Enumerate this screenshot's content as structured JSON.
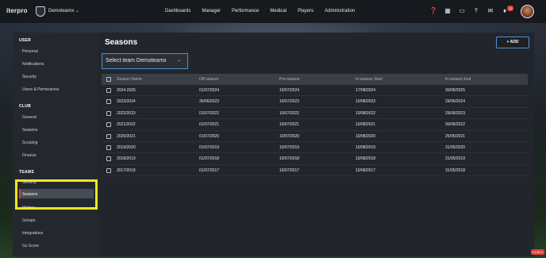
{
  "topbar": {
    "logo": "iterpro",
    "team_name": "Demoteamx",
    "nav": [
      "Dashboards",
      "Manager",
      "Performance",
      "Medical",
      "Players",
      "Administration"
    ],
    "notification_count": "13"
  },
  "sidebar": {
    "user_heading": "USER",
    "user_items": [
      "Personal",
      "Notifications",
      "Security",
      "Users & Permissions"
    ],
    "club_heading": "CLUB",
    "club_items": [
      "General",
      "Seasons",
      "Scouting",
      "Finance"
    ],
    "teams_heading": "TEAMS",
    "teams_items": [
      "General",
      "Seasons",
      "Metrics",
      "Groups",
      "Integrations",
      "Go Score"
    ]
  },
  "main": {
    "title": "Seasons",
    "add_label": "+ ADD",
    "team_select_label": "Select team",
    "team_select_value": "Demoteamx",
    "columns": [
      "Season Name",
      "Off-season",
      "Pre-season",
      "In-season Start",
      "In-season End"
    ],
    "rows": [
      [
        "2024-2025",
        "01/07/2024",
        "10/07/2024",
        "17/08/2024",
        "30/06/2025"
      ],
      [
        "2023/2024",
        "30/06/2023",
        "10/07/2023",
        "10/08/2023",
        "29/06/2024"
      ],
      [
        "2022/2023",
        "01/07/2022",
        "10/07/2022",
        "10/08/2022",
        "29/06/2023"
      ],
      [
        "2021/2022",
        "01/07/2021",
        "10/07/2021",
        "10/08/2021",
        "30/06/2022"
      ],
      [
        "2020/2021",
        "01/07/2020",
        "10/07/2020",
        "10/08/2020",
        "25/05/2021"
      ],
      [
        "2019/2020",
        "01/07/2019",
        "10/07/2019",
        "10/08/2019",
        "31/05/2020"
      ],
      [
        "2018/2019",
        "01/07/2018",
        "10/07/2018",
        "10/08/2018",
        "31/05/2019"
      ],
      [
        "2017/2018",
        "01/07/2017",
        "10/07/2017",
        "10/08/2017",
        "31/05/2018"
      ]
    ]
  },
  "version": "v1.82.1",
  "colors": {
    "accent": "#d3452f",
    "highlight": "#f2e51f",
    "focus": "#4f8fd0"
  }
}
